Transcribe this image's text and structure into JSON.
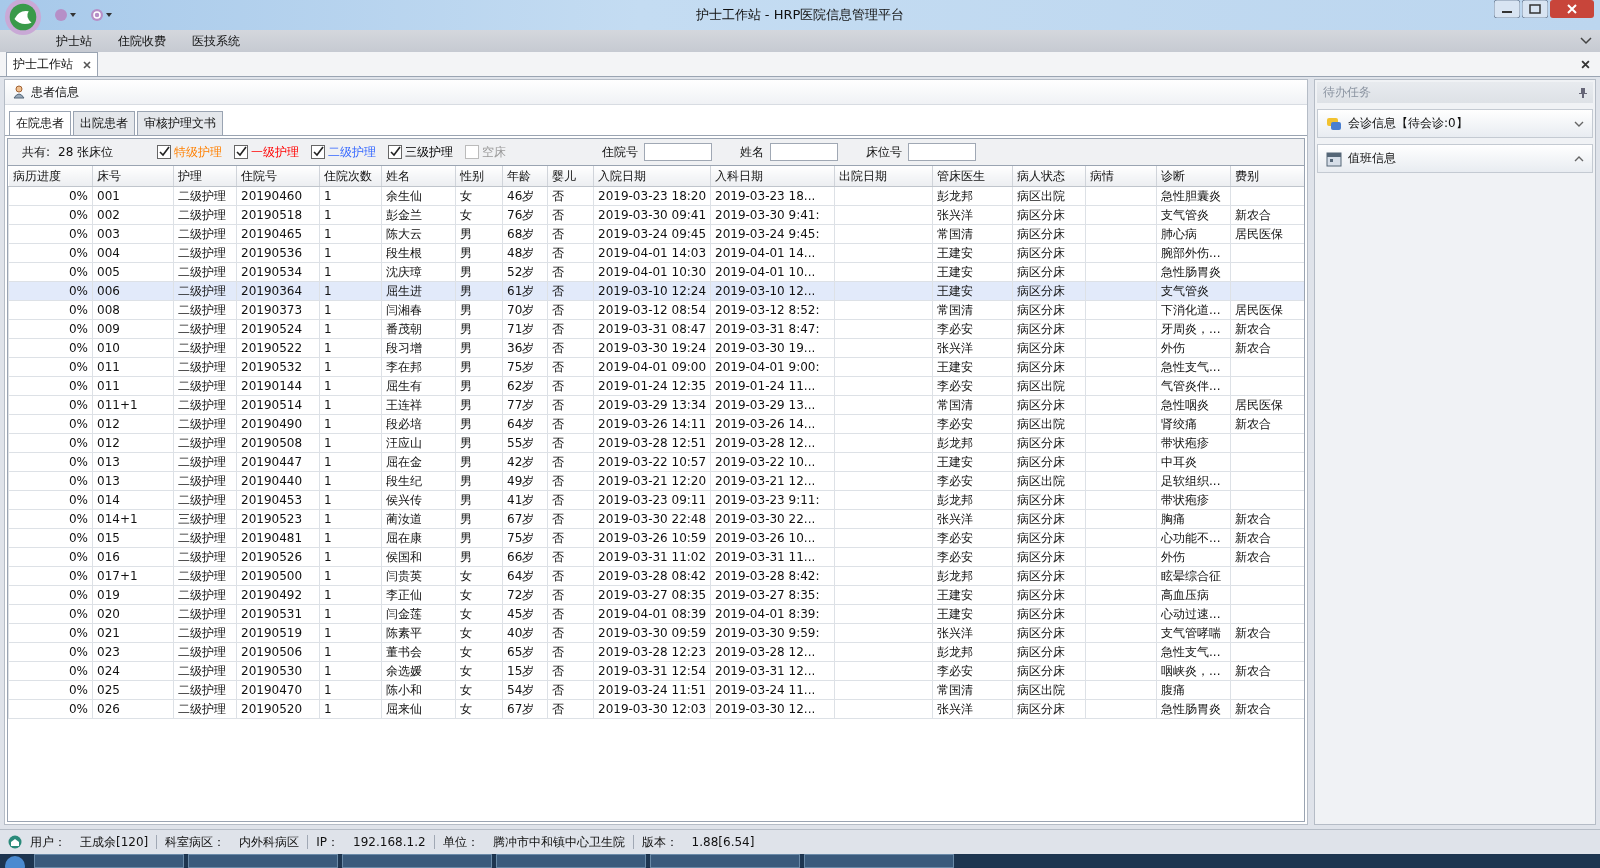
{
  "window": {
    "title": "护士工作站 - HRP医院信息管理平台"
  },
  "menu": [
    {
      "label": "护士站"
    },
    {
      "label": "住院收费"
    },
    {
      "label": "医技系统"
    }
  ],
  "doc_tabs": [
    {
      "label": "护士工作站",
      "selected": true
    }
  ],
  "section_title": "患者信息",
  "sub_tabs": [
    {
      "label": "在院患者",
      "selected": true
    },
    {
      "label": "出院患者",
      "selected": false
    },
    {
      "label": "审核护理文书",
      "selected": false
    }
  ],
  "filter": {
    "total_label": "共有:",
    "total_value": "28",
    "total_unit": "张床位",
    "levels": [
      {
        "label": "特级护理",
        "checked": true,
        "disabled": false,
        "kind": "special"
      },
      {
        "label": "一级护理",
        "checked": true,
        "disabled": false,
        "kind": "first"
      },
      {
        "label": "二级护理",
        "checked": true,
        "disabled": false,
        "kind": "second"
      },
      {
        "label": "三级护理",
        "checked": true,
        "disabled": false,
        "kind": "third"
      },
      {
        "label": "空床",
        "checked": false,
        "disabled": true,
        "kind": "empty"
      }
    ],
    "fields": [
      {
        "label": "住院号"
      },
      {
        "label": "姓名"
      },
      {
        "label": "床位号"
      }
    ]
  },
  "table": {
    "columns": [
      "病历进度",
      "床号",
      "护理",
      "住院号",
      "住院次数",
      "姓名",
      "性别",
      "年龄",
      "婴儿",
      "入院日期",
      "入科日期",
      "出院日期",
      "管床医生",
      "病人状态",
      "病情",
      "诊断",
      "费别"
    ],
    "rows": [
      {
        "selected": false,
        "cells": [
          "0%",
          "001",
          "二级护理",
          "20190460",
          "1",
          "余生仙",
          "女",
          "46岁",
          "否",
          "2019-03-23 18:20",
          "2019-03-23 18...",
          "",
          "彭龙邦",
          "病区出院",
          "",
          "急性胆囊炎",
          ""
        ]
      },
      {
        "selected": false,
        "cells": [
          "0%",
          "002",
          "二级护理",
          "20190518",
          "1",
          "彭金兰",
          "女",
          "76岁",
          "否",
          "2019-03-30 09:41",
          "2019-03-30 9:41:",
          "",
          "张兴洋",
          "病区分床",
          "",
          "支气管炎",
          "新农合"
        ]
      },
      {
        "selected": false,
        "cells": [
          "0%",
          "003",
          "二级护理",
          "20190465",
          "1",
          "陈大云",
          "男",
          "68岁",
          "否",
          "2019-03-24 09:45",
          "2019-03-24 9:45:",
          "",
          "常国清",
          "病区分床",
          "",
          "肺心病",
          "居民医保"
        ]
      },
      {
        "selected": false,
        "cells": [
          "0%",
          "004",
          "二级护理",
          "20190536",
          "1",
          "段生根",
          "男",
          "48岁",
          "否",
          "2019-04-01 14:03",
          "2019-04-01 14...",
          "",
          "王建安",
          "病区分床",
          "",
          "腕部外伤...",
          ""
        ]
      },
      {
        "selected": false,
        "cells": [
          "0%",
          "005",
          "二级护理",
          "20190534",
          "1",
          "沈庆璋",
          "男",
          "52岁",
          "否",
          "2019-04-01 10:30",
          "2019-04-01 10...",
          "",
          "王建安",
          "病区分床",
          "",
          "急性肠胃炎",
          ""
        ]
      },
      {
        "selected": true,
        "cells": [
          "0%",
          "006",
          "二级护理",
          "20190364",
          "1",
          "屈生进",
          "男",
          "61岁",
          "否",
          "2019-03-10 12:24",
          "2019-03-10 12...",
          "",
          "王建安",
          "病区分床",
          "",
          "支气管炎",
          ""
        ]
      },
      {
        "selected": false,
        "cells": [
          "0%",
          "008",
          "二级护理",
          "20190373",
          "1",
          "闫湘春",
          "男",
          "70岁",
          "否",
          "2019-03-12 08:54",
          "2019-03-12 8:52:",
          "",
          "常国清",
          "病区分床",
          "",
          "下消化道...",
          "居民医保"
        ]
      },
      {
        "selected": false,
        "cells": [
          "0%",
          "009",
          "二级护理",
          "20190524",
          "1",
          "番茂朝",
          "男",
          "71岁",
          "否",
          "2019-03-31 08:47",
          "2019-03-31 8:47:",
          "",
          "李必安",
          "病区分床",
          "",
          "牙周炎，...",
          "新农合"
        ]
      },
      {
        "selected": false,
        "cells": [
          "0%",
          "010",
          "二级护理",
          "20190522",
          "1",
          "段习增",
          "男",
          "36岁",
          "否",
          "2019-03-30 19:24",
          "2019-03-30 19...",
          "",
          "张兴洋",
          "病区分床",
          "",
          "外伤",
          "新农合"
        ]
      },
      {
        "selected": false,
        "cells": [
          "0%",
          "011",
          "二级护理",
          "20190532",
          "1",
          "李在邦",
          "男",
          "75岁",
          "否",
          "2019-04-01 09:00",
          "2019-04-01 9:00:",
          "",
          "王建安",
          "病区分床",
          "",
          "急性支气...",
          ""
        ]
      },
      {
        "selected": false,
        "cells": [
          "0%",
          "011",
          "二级护理",
          "20190144",
          "1",
          "屈生有",
          "男",
          "62岁",
          "否",
          "2019-01-24 12:35",
          "2019-01-24 11...",
          "",
          "李必安",
          "病区出院",
          "",
          "气管炎伴...",
          ""
        ]
      },
      {
        "selected": false,
        "cells": [
          "0%",
          "011+1",
          "二级护理",
          "20190514",
          "1",
          "王连祥",
          "男",
          "77岁",
          "否",
          "2019-03-29 13:34",
          "2019-03-29 13...",
          "",
          "常国清",
          "病区分床",
          "",
          "急性咽炎",
          "居民医保"
        ]
      },
      {
        "selected": false,
        "cells": [
          "0%",
          "012",
          "二级护理",
          "20190490",
          "1",
          "段必培",
          "男",
          "64岁",
          "否",
          "2019-03-26 14:11",
          "2019-03-26 14...",
          "",
          "李必安",
          "病区出院",
          "",
          "肾绞痛",
          "新农合"
        ]
      },
      {
        "selected": false,
        "cells": [
          "0%",
          "012",
          "二级护理",
          "20190508",
          "1",
          "汪应山",
          "男",
          "55岁",
          "否",
          "2019-03-28 12:51",
          "2019-03-28 12...",
          "",
          "彭龙邦",
          "病区分床",
          "",
          "带状疱疹",
          ""
        ]
      },
      {
        "selected": false,
        "cells": [
          "0%",
          "013",
          "二级护理",
          "20190447",
          "1",
          "屈在金",
          "男",
          "42岁",
          "否",
          "2019-03-22 10:57",
          "2019-03-22 10...",
          "",
          "王建安",
          "病区分床",
          "",
          "中耳炎",
          ""
        ]
      },
      {
        "selected": false,
        "cells": [
          "0%",
          "013",
          "二级护理",
          "20190440",
          "1",
          "段生纪",
          "男",
          "49岁",
          "否",
          "2019-03-21 12:20",
          "2019-03-21 12...",
          "",
          "李必安",
          "病区出院",
          "",
          "足软组织...",
          ""
        ]
      },
      {
        "selected": false,
        "cells": [
          "0%",
          "014",
          "二级护理",
          "20190453",
          "1",
          "侯兴传",
          "男",
          "41岁",
          "否",
          "2019-03-23 09:11",
          "2019-03-23 9:11:",
          "",
          "彭龙邦",
          "病区分床",
          "",
          "带状疱疹",
          ""
        ]
      },
      {
        "selected": false,
        "cells": [
          "0%",
          "014+1",
          "三级护理",
          "20190523",
          "1",
          "蔺汝道",
          "男",
          "67岁",
          "否",
          "2019-03-30 22:48",
          "2019-03-30 22...",
          "",
          "张兴洋",
          "病区分床",
          "",
          "胸痛",
          "新农合"
        ]
      },
      {
        "selected": false,
        "cells": [
          "0%",
          "015",
          "二级护理",
          "20190481",
          "1",
          "屈在康",
          "男",
          "75岁",
          "否",
          "2019-03-26 10:59",
          "2019-03-26 10...",
          "",
          "李必安",
          "病区分床",
          "",
          "心功能不...",
          "新农合"
        ]
      },
      {
        "selected": false,
        "cells": [
          "0%",
          "016",
          "二级护理",
          "20190526",
          "1",
          "侯国和",
          "男",
          "66岁",
          "否",
          "2019-03-31 11:02",
          "2019-03-31 11...",
          "",
          "李必安",
          "病区分床",
          "",
          "外伤",
          "新农合"
        ]
      },
      {
        "selected": false,
        "cells": [
          "0%",
          "017+1",
          "二级护理",
          "20190500",
          "1",
          "闫贵英",
          "女",
          "64岁",
          "否",
          "2019-03-28 08:42",
          "2019-03-28 8:42:",
          "",
          "彭龙邦",
          "病区分床",
          "",
          "眩晕综合征",
          ""
        ]
      },
      {
        "selected": false,
        "cells": [
          "0%",
          "019",
          "二级护理",
          "20190492",
          "1",
          "李正仙",
          "女",
          "72岁",
          "否",
          "2019-03-27 08:35",
          "2019-03-27 8:35:",
          "",
          "王建安",
          "病区分床",
          "",
          "高血压病",
          ""
        ]
      },
      {
        "selected": false,
        "cells": [
          "0%",
          "020",
          "二级护理",
          "20190531",
          "1",
          "闫金莲",
          "女",
          "45岁",
          "否",
          "2019-04-01 08:39",
          "2019-04-01 8:39:",
          "",
          "王建安",
          "病区分床",
          "",
          "心动过速...",
          ""
        ]
      },
      {
        "selected": false,
        "cells": [
          "0%",
          "021",
          "二级护理",
          "20190519",
          "1",
          "陈素平",
          "女",
          "40岁",
          "否",
          "2019-03-30 09:59",
          "2019-03-30 9:59:",
          "",
          "张兴洋",
          "病区分床",
          "",
          "支气管哮喘",
          "新农合"
        ]
      },
      {
        "selected": false,
        "cells": [
          "0%",
          "023",
          "二级护理",
          "20190506",
          "1",
          "董书会",
          "女",
          "65岁",
          "否",
          "2019-03-28 12:23",
          "2019-03-28 12...",
          "",
          "彭龙邦",
          "病区分床",
          "",
          "急性支气...",
          ""
        ]
      },
      {
        "selected": false,
        "cells": [
          "0%",
          "024",
          "二级护理",
          "20190530",
          "1",
          "余选媛",
          "女",
          "15岁",
          "否",
          "2019-03-31 12:54",
          "2019-03-31 12...",
          "",
          "李必安",
          "病区分床",
          "",
          "咽峡炎，...",
          "新农合"
        ]
      },
      {
        "selected": false,
        "cells": [
          "0%",
          "025",
          "二级护理",
          "20190470",
          "1",
          "陈小和",
          "女",
          "54岁",
          "否",
          "2019-03-24 11:51",
          "2019-03-24 11...",
          "",
          "常国清",
          "病区出院",
          "",
          "腹痛",
          ""
        ]
      },
      {
        "selected": false,
        "cells": [
          "0%",
          "026",
          "二级护理",
          "20190520",
          "1",
          "屈来仙",
          "女",
          "67岁",
          "否",
          "2019-03-30 12:03",
          "2019-03-30 12...",
          "",
          "张兴洋",
          "病区分床",
          "",
          "急性肠胃炎",
          "新农合"
        ]
      }
    ]
  },
  "side_panel": {
    "title": "待办任务",
    "sections": [
      {
        "label": "会诊信息【待会诊:0】",
        "expanded": false
      },
      {
        "label": "值班信息",
        "expanded": true
      }
    ]
  },
  "status_bar": [
    {
      "label": "用户：",
      "value": "王成余[120]"
    },
    {
      "label": "科室病区：",
      "value": "内外科病区"
    },
    {
      "label": "IP：",
      "value": "192.168.1.2"
    },
    {
      "label": "单位：",
      "value": "腾冲市中和镇中心卫生院"
    },
    {
      "label": "版本：",
      "value": "1.88[6.54]"
    }
  ]
}
